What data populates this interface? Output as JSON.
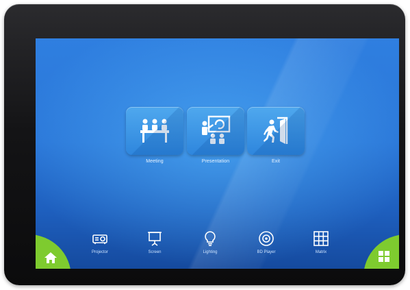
{
  "screen": {
    "background_top": "#2f7fe0",
    "background_bottom": "#154a9e",
    "tile_color": "#3f99e8",
    "accent_green": "#7ecb2f"
  },
  "modes": [
    {
      "label": "Meeting",
      "icon": "meeting-icon"
    },
    {
      "label": "Presentation",
      "icon": "presentation-icon"
    },
    {
      "label": "Exit",
      "icon": "exit-icon"
    }
  ],
  "dock": [
    {
      "label": "Projector",
      "icon": "projector-icon"
    },
    {
      "label": "Screen",
      "icon": "projection-screen-icon"
    },
    {
      "label": "Lighting",
      "icon": "lightbulb-icon"
    },
    {
      "label": "BD Player",
      "icon": "disc-icon"
    },
    {
      "label": "Matrix",
      "icon": "grid-icon"
    }
  ],
  "corners": {
    "left_icon": "home-icon",
    "right_icon": "apps-grid-icon"
  }
}
